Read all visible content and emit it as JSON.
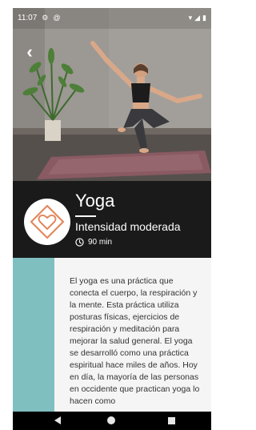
{
  "status_bar": {
    "time": "11:07",
    "left_icons": [
      "gear-icon",
      "at-icon"
    ],
    "right_icons": [
      "wifi-icon",
      "signal-icon",
      "battery-icon"
    ]
  },
  "hero": {
    "image_subject": "woman doing a balancing yoga pose on a mat",
    "back_icon": "chevron-left-icon"
  },
  "class": {
    "title": "Yoga",
    "intensity": "Intensidad moderada",
    "duration": "90 min",
    "icon": "heart-diamond-icon"
  },
  "description": "El yoga es una práctica que conecta el cuerpo, la respiración y la mente. Esta práctica utiliza posturas físicas, ejercicios de respiración y meditación para mejorar la salud general. El yoga se desarrolló como una práctica espiritual hace miles de años. Hoy en día, la mayoría de las personas en occidente que practican yoga lo hacen como",
  "colors": {
    "panel_dark": "#1a1a1a",
    "accent_teal": "#80bfc0",
    "icon_orange": "#e2895f",
    "card_background": "#f5f5f5"
  },
  "nav_bar": {
    "buttons": [
      "back",
      "home",
      "recents"
    ]
  }
}
